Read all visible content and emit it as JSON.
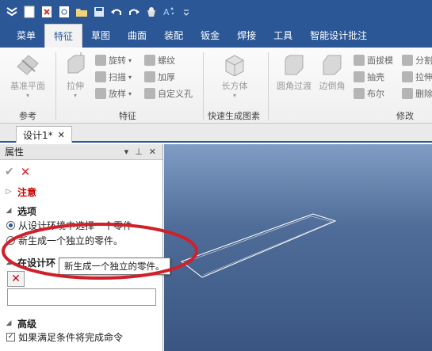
{
  "qat": {
    "icons": [
      "app-logo-icon",
      "new-icon",
      "open-icon",
      "preview-icon",
      "folder-icon",
      "save-icon",
      "undo-icon",
      "redo-icon",
      "cup-icon",
      "sparkle-icon",
      "dropdown-icon"
    ]
  },
  "ribbon": {
    "tabs": [
      {
        "label": "菜单",
        "active": false
      },
      {
        "label": "特征",
        "active": true
      },
      {
        "label": "草图",
        "active": false
      },
      {
        "label": "曲面",
        "active": false
      },
      {
        "label": "装配",
        "active": false
      },
      {
        "label": "钣金",
        "active": false
      },
      {
        "label": "焊接",
        "active": false
      },
      {
        "label": "工具",
        "active": false
      },
      {
        "label": "智能设计批注",
        "active": false
      }
    ],
    "groups": {
      "reference": {
        "label": "参考",
        "base_plane": "基准平面"
      },
      "feature": {
        "label": "特征",
        "extrude": "拉伸",
        "revolve": "旋转",
        "sweep": "扫描",
        "loft": "放样",
        "thread": "螺纹",
        "thicken": "加厚",
        "custom_hole": "自定义孔"
      },
      "quick": {
        "label": "快速生成图素",
        "cuboid": "长方体"
      },
      "modify": {
        "label": "修改",
        "fillet": "圆角过渡",
        "chamfer": "边倒角",
        "draft": "面拔模",
        "shell": "抽壳",
        "boolean": "布尔",
        "split": "分割",
        "stretch": "拉伸",
        "delete": "删除"
      }
    }
  },
  "document": {
    "tab_title": "设计1*"
  },
  "panel": {
    "title": "属性",
    "notice": "注意",
    "options_header": "选项",
    "option_1": "从设计环境中选择一个零件",
    "option_2": "新生成一个独立的零件。",
    "in_design_header": "在设计环",
    "advanced_header": "高级",
    "advanced_check": "如果满足条件将完成命令"
  },
  "tooltip": {
    "text": "新生成一个独立的零件。"
  },
  "colors": {
    "ribbon_blue": "#2b5797",
    "annotation_red": "#d0202a",
    "viewport_top": "#7f9dc4",
    "viewport_bottom": "#3a5582"
  }
}
